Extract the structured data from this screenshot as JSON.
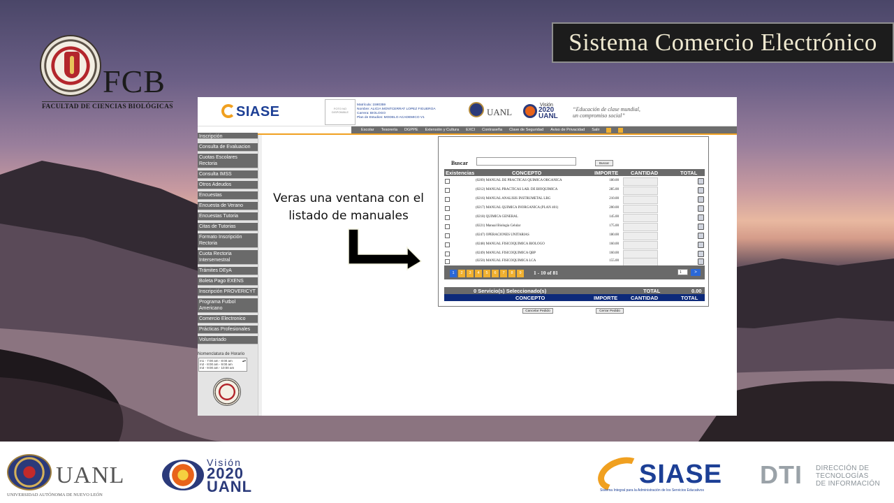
{
  "slide": {
    "title": "Sistema Comercio Electrónico",
    "note": "Veras una ventana con el listado de manuales"
  },
  "fcb_logo": {
    "text": "FCB",
    "subtitle": "FACULTAD DE CIENCIAS BIOLÓGICAS"
  },
  "app": {
    "brand": "SIASE",
    "photo_placeholder": "FOTO NO DISPONIBLE",
    "student": {
      "matricula": "Matrícula: 1590359",
      "nombre": "Nombre: ALICIA MONTCERRAT LOPEZ FIGUEROA",
      "carrera": "Carrera: BIOLOGO",
      "plan": "Plan de Estudios: MODELO ACADEMICO V1"
    },
    "uanl": "UANL",
    "vision": {
      "top": "Visión",
      "year": "2020",
      "org": "UANL"
    },
    "motto_1": "“Educación de clase mundial,",
    "motto_2": "un compromiso social”",
    "nav": [
      "Escolar",
      "Tesorería",
      "DGPPE",
      "Extensión y Cultura",
      "EXCI",
      "Contraseña",
      "Clave de Seguridad",
      "Aviso de Privacidad",
      "Salir"
    ],
    "sidebar": [
      "Inscripción",
      "Consulta de Evaluacion",
      "Cuotas Escolares Rectoria",
      "Consulta IMSS",
      "Otros Adeudos",
      "Encuestas",
      "Encuesta de Verano",
      "Encuestas Tutoria",
      "Citas de Tutorias",
      "Formato Inscripción Rectoria",
      "Cuota Rectoria Intersemestral",
      "Trámites DEyA",
      "Boleta Pago EXENS",
      "Inscripción PROVERICYT",
      "Programa Futbol Americano",
      "Comercio Electronico",
      "Prácticas Profesionales",
      "Voluntariado"
    ],
    "nomenclatura": {
      "label": "Nomenclatura de Horario",
      "items": [
        "m1 - 7:00 am - 8:00 am",
        "m2 - 8:00 am - 9:00 am",
        "m3 - 9:00 am - 10:00 am"
      ]
    }
  },
  "order": {
    "search_label": "Buscar",
    "search_value": "",
    "search_button": "Buscar",
    "columns": [
      "Existencias",
      "CONCEPTO",
      "IMPORTE",
      "CANTIDAD",
      "TOTAL"
    ],
    "rows": [
      {
        "concept": "(0209) MANUAL DE PRACTICAS QUIMICA ORGANICA",
        "importe": "180.00"
      },
      {
        "concept": "(0212) MANUAL PRACTICAS LAB. DE BIOQUIMICA",
        "importe": "285.00"
      },
      {
        "concept": "(0216) MANUAL ANALISIS INSTRUMETAL LBG",
        "importe": "210.00"
      },
      {
        "concept": "(0217) MANUAL QUIMICA INORGANICA (PLAN 401)",
        "importe": "200.00"
      },
      {
        "concept": "(0218) QUIMICA GENERAL",
        "importe": "145.00"
      },
      {
        "concept": "(0221) Manual Biologia Celular",
        "importe": "175.00"
      },
      {
        "concept": "(0247) OPERACIONES UNITARIAS",
        "importe": "180.00"
      },
      {
        "concept": "(0248) MANUAL FISICOQUIMICA BIOLOGO",
        "importe": "160.00"
      },
      {
        "concept": "(0249) MANUAL FISICOQUIMICA QBP",
        "importe": "160.00"
      },
      {
        "concept": "(0250) MANUAL FISICOQUIMICA LCA",
        "importe": "155.00"
      }
    ],
    "pages": [
      "1",
      "2",
      "3",
      "4",
      "5",
      "6",
      "7",
      "8",
      "9"
    ],
    "page_range": "1 - 10 of 81",
    "page_input": "1",
    "page_go": ">",
    "selected": "0 Servicio(s) Seleccionado(s)",
    "total_label": "TOTAL",
    "total_value": "0.00",
    "foot": [
      "CONCEPTO",
      "IMPORTE",
      "CANTIDAD",
      "TOTAL"
    ],
    "cancel": "Cancelar Pedido",
    "close": "Cerrar Pedido"
  },
  "footer": {
    "uanl": "UANL",
    "uanl_sub": "UNIVERSIDAD AUTÓNOMA DE NUEVO LEÓN",
    "vision_top": "Visión",
    "vision_year": "2020",
    "vision_org": "UANL",
    "siase": "SIASE",
    "siase_sub": "Sistema Integral para la Administración de los Servicios Educativos",
    "dti": "DTI",
    "dti_sub_1": "DIRECCIÓN DE",
    "dti_sub_2": "TECNOLOGÍAS",
    "dti_sub_3": "DE INFORMACIÓN"
  },
  "colors": {
    "menu": "#6a6a6a",
    "accent": "#f0a020",
    "pager_active": "#2a68d8",
    "total_bar": "#0d2a7a"
  }
}
